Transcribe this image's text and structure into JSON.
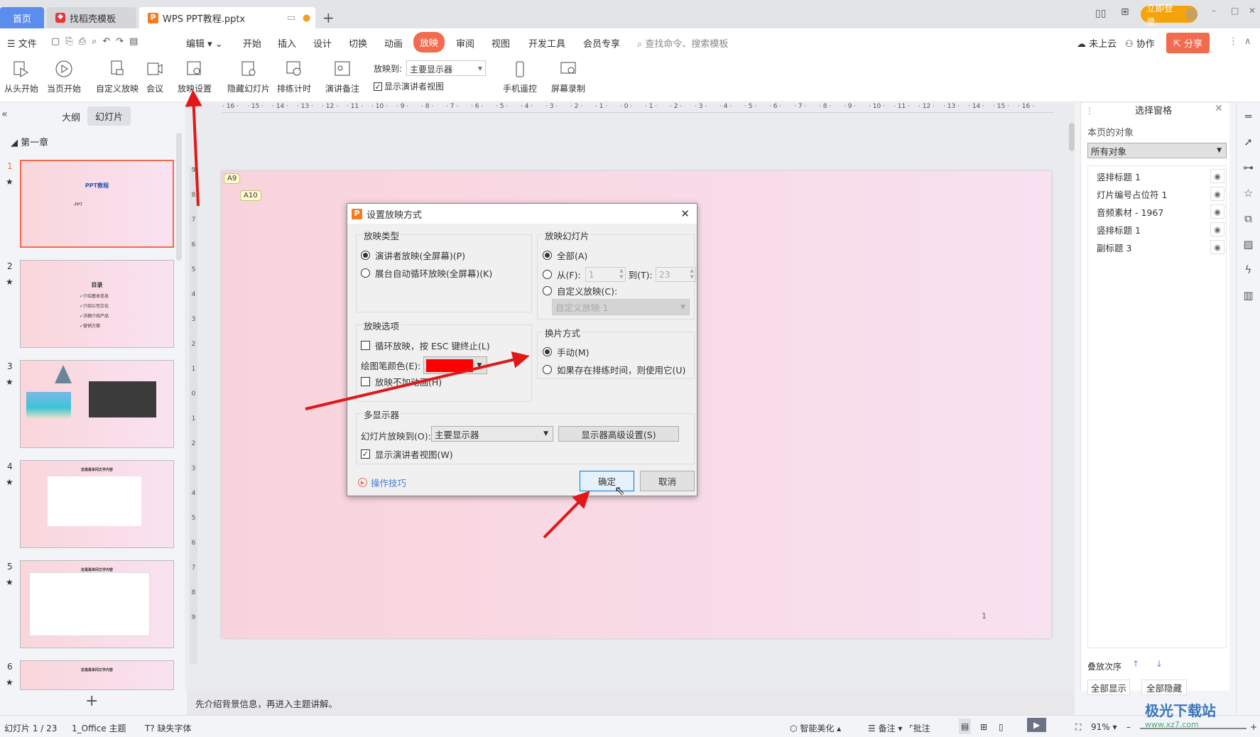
{
  "tabs": [
    {
      "label": "首页"
    },
    {
      "label": "找稻壳模板"
    },
    {
      "label": "WPS PPT教程.pptx"
    }
  ],
  "titlebar": {
    "login": "立即登录"
  },
  "menu": {
    "file": "文件",
    "edit": "编辑",
    "items": [
      "开始",
      "插入",
      "设计",
      "切换",
      "动画",
      "放映",
      "审阅",
      "视图",
      "开发工具",
      "会员专享"
    ],
    "active": "放映",
    "search_placeholder": "查找命令、搜索模板",
    "cloud": "未上云",
    "collab": "协作",
    "share": "分享"
  },
  "ribbon": {
    "from_start": "从头开始",
    "from_current": "当页开始",
    "custom_show": "自定义放映",
    "meeting": "会议",
    "show_settings": "放映设置",
    "hide_slide": "隐藏幻灯片",
    "rehearse": "排练计时",
    "notes": "演讲备注",
    "show_to_label": "放映到:",
    "show_to_value": "主要显示器",
    "presenter_view": "显示演讲者视图",
    "phone_remote": "手机遥控",
    "screen_record": "屏幕录制"
  },
  "left": {
    "tab_outline": "大纲",
    "tab_slides": "幻灯片",
    "section": "第一章",
    "slides": [
      {
        "n": "1",
        "title": "PPT教程",
        "sub": "-PPT"
      },
      {
        "n": "2",
        "title": "目录",
        "lines": [
          "✓介绍基本信息",
          "✓介绍公司文化",
          "✓详细介绍产品",
          "✓营销方案"
        ]
      },
      {
        "n": "3"
      },
      {
        "n": "4",
        "title": "这是是单间文字内容"
      },
      {
        "n": "5",
        "title": "这是是单间文字内容"
      },
      {
        "n": "6",
        "title": "这是是单间文字内容"
      }
    ]
  },
  "ruler": {
    "h_max": 16,
    "v_max": 9
  },
  "slide": {
    "tag1": "A9",
    "tag2": "A10",
    "page_number": "1"
  },
  "dialog": {
    "title": "设置放映方式",
    "show_type": {
      "label": "放映类型",
      "opt1": "演讲者放映(全屏幕)(P)",
      "opt2": "展台自动循环放映(全屏幕)(K)",
      "selected": "opt1"
    },
    "show_options": {
      "label": "放映选项",
      "loop": "循环放映，按 ESC 键终止(L)",
      "loop_checked": false,
      "pen_label": "绘图笔颜色(E):",
      "pen_color": "#ff0000",
      "no_anim": "放映不加动画(H)",
      "no_anim_checked": false
    },
    "slides": {
      "label": "放映幻灯片",
      "all": "全部(A)",
      "from": "从(F):",
      "from_value": "1",
      "to": "到(T):",
      "to_value": "23",
      "custom": "自定义放映(C):",
      "custom_value": "自定义放映 1",
      "selected": "all"
    },
    "advance": {
      "label": "换片方式",
      "manual": "手动(M)",
      "timings": "如果存在排练时间，则使用它(U)",
      "selected": "manual"
    },
    "monitors": {
      "label": "多显示器",
      "show_on": "幻灯片放映到(O):",
      "show_on_value": "主要显示器",
      "advanced": "显示器高级设置(S)",
      "presenter": "显示演讲者视图(W)",
      "presenter_checked": true
    },
    "tips": "操作技巧",
    "ok": "确定",
    "cancel": "取消"
  },
  "pane": {
    "title": "选择窗格",
    "objects_label": "本页的对象",
    "filter": "所有对象",
    "objects": [
      "竖排标题 1",
      "灯片编号占位符 1",
      "音频素材 - 1967",
      "竖排标题 1",
      "副标题 3"
    ],
    "order": "叠放次序",
    "show_all": "全部显示",
    "hide_all": "全部隐藏"
  },
  "notes": "先介绍背景信息，再进入主题讲解。",
  "status": {
    "slide": "幻灯片 1 / 23",
    "theme": "1_Office 主题",
    "missing_font": "缺失字体",
    "beautify": "智能美化",
    "notes": "备注",
    "comment": "批注",
    "zoom": "91%"
  },
  "watermark": {
    "text": "极光下载站",
    "url": "www.xz7.com"
  },
  "colors": {
    "accent": "#f26b4e",
    "tab_home": "#5b8def",
    "annotation": "#e01818"
  }
}
